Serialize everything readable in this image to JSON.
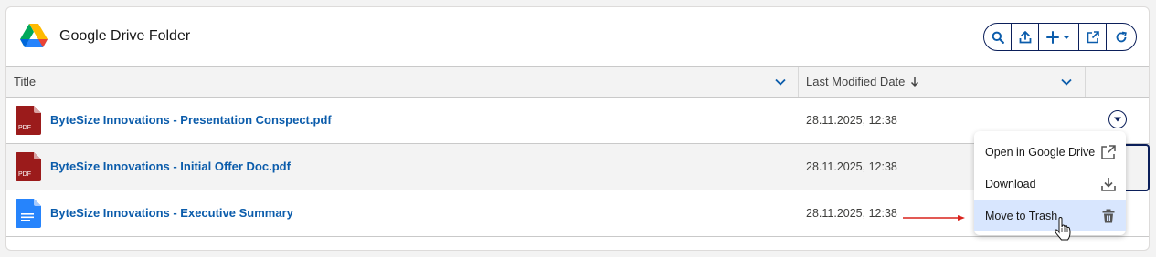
{
  "header": {
    "title": "Google Drive Folder",
    "logo_icon": "google-drive-icon",
    "actions": [
      {
        "name": "search",
        "icon": "search-icon"
      },
      {
        "name": "upload",
        "icon": "upload-icon"
      },
      {
        "name": "add",
        "icon": "plus-dropdown-icon"
      },
      {
        "name": "open-external",
        "icon": "external-link-icon"
      },
      {
        "name": "refresh",
        "icon": "refresh-icon"
      }
    ]
  },
  "table": {
    "columns": {
      "title": "Title",
      "modified": "Last Modified Date",
      "modified_sort": "descending"
    },
    "rows": [
      {
        "name": "ByteSize Innovations - Presentation Conspect.pdf",
        "date": "28.11.2025, 12:38",
        "type": "pdf",
        "type_label": "PDF"
      },
      {
        "name": "ByteSize Innovations - Initial Offer Doc.pdf",
        "date": "28.11.2025, 12:38",
        "type": "pdf",
        "type_label": "PDF"
      },
      {
        "name": "ByteSize Innovations - Executive Summary",
        "date": "28.11.2025, 12:38",
        "type": "doc",
        "type_label": ""
      }
    ]
  },
  "menu": {
    "items": [
      {
        "label": "Open in Google Drive",
        "icon": "external-link-icon"
      },
      {
        "label": "Download",
        "icon": "download-icon"
      },
      {
        "label": "Move to Trash",
        "icon": "trash-icon",
        "active": true
      }
    ]
  },
  "colors": {
    "accent": "#0b5cab",
    "border_dark": "#0b1f5a",
    "pdf_red": "#9b1b1b",
    "doc_blue": "#2684fc",
    "annotation_arrow": "#d9221c",
    "menu_active_bg": "#d8e6fe"
  }
}
